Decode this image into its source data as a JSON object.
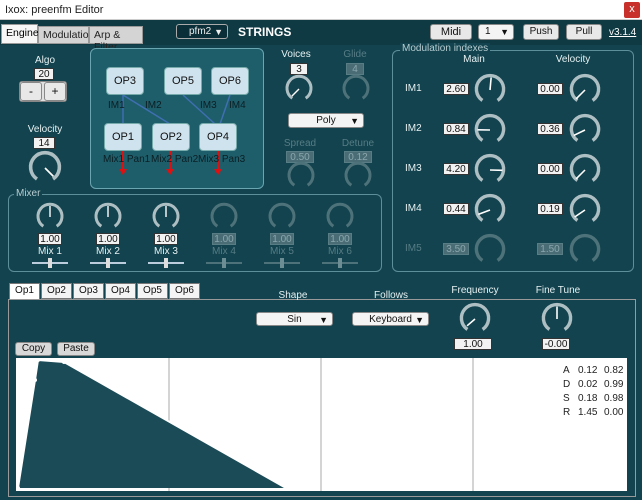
{
  "window": {
    "title": "Ixox: preenfm Editor",
    "close": "x"
  },
  "tabs": [
    "Engine",
    "Modulation",
    "Arp & Filter"
  ],
  "header": {
    "preset_select": "pfm2",
    "preset_name": "STRINGS",
    "midi": "Midi",
    "channel": "1",
    "push": "Push",
    "pull": "Pull",
    "version": "v3.1.4"
  },
  "algo": {
    "label": "Algo",
    "value": "20",
    "minus": "-",
    "plus": "+"
  },
  "velocity": {
    "label": "Velocity",
    "value": "14"
  },
  "algo_diagram": {
    "ops": [
      "OP3",
      "OP5",
      "OP6",
      "OP1",
      "OP2",
      "OP4"
    ],
    "im_labels": [
      "IM1",
      "IM2",
      "IM3",
      "IM4"
    ],
    "out_labels": [
      "Mix1 Pan1",
      "Mix2 Pan2",
      "Mix3 Pan3"
    ]
  },
  "voices": {
    "label": "Voices",
    "value": "3"
  },
  "glide": {
    "label": "Glide",
    "value": "4"
  },
  "mode": {
    "value": "Poly"
  },
  "spread": {
    "label": "Spread",
    "value": "0.50"
  },
  "detune": {
    "label": "Detune",
    "value": "0.12"
  },
  "modulation": {
    "title": "Modulation indexes",
    "main_header": "Main",
    "velocity_header": "Velocity",
    "rows": [
      {
        "label": "IM1",
        "main": "2.60",
        "vel": "0.00",
        "main_level": 0.52,
        "vel_level": 0.0
      },
      {
        "label": "IM2",
        "main": "0.84",
        "vel": "0.36",
        "main_level": 0.17,
        "vel_level": 0.07
      },
      {
        "label": "IM3",
        "main": "4.20",
        "vel": "0.00",
        "main_level": 0.84,
        "vel_level": 0.0
      },
      {
        "label": "IM4",
        "main": "0.44",
        "vel": "0.19",
        "main_level": 0.09,
        "vel_level": 0.04
      },
      {
        "label": "IM5",
        "main": "3.50",
        "vel": "1.50",
        "main_level": 0.7,
        "vel_level": 0.3
      }
    ]
  },
  "mixer": {
    "title": "Mixer",
    "channels": [
      {
        "label": "Mix 1",
        "value": "1.00"
      },
      {
        "label": "Mix 2",
        "value": "1.00"
      },
      {
        "label": "Mix 3",
        "value": "1.00"
      },
      {
        "label": "Mix 4",
        "value": "1.00"
      },
      {
        "label": "Mix 5",
        "value": "1.00"
      },
      {
        "label": "Mix 6",
        "value": "1.00"
      }
    ]
  },
  "op_tabs": [
    "Op1",
    "Op2",
    "Op3",
    "Op4",
    "Op5",
    "Op6"
  ],
  "operator": {
    "shape_label": "Shape",
    "shape": "Sin",
    "follows_label": "Follows",
    "follows": "Keyboard",
    "frequency_label": "Frequency",
    "frequency": "1.00",
    "finetune_label": "Fine Tune",
    "finetune": "-0.00",
    "copy": "Copy",
    "paste": "Paste"
  },
  "envelope": {
    "rows": [
      {
        "k": "A",
        "t": "0.12",
        "l": "0.82"
      },
      {
        "k": "D",
        "t": "0.02",
        "l": "0.99"
      },
      {
        "k": "S",
        "t": "0.18",
        "l": "0.98"
      },
      {
        "k": "R",
        "t": "1.45",
        "l": "0.00"
      }
    ]
  }
}
